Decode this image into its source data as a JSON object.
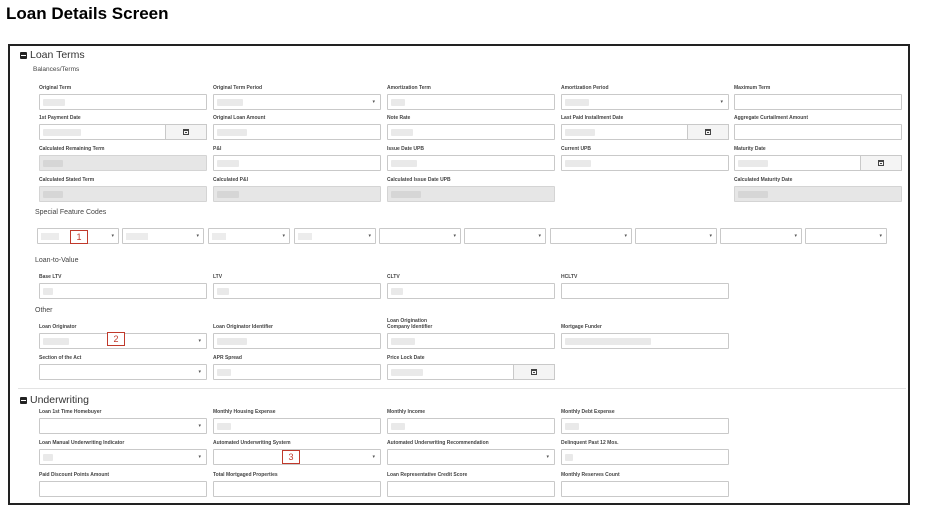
{
  "page": {
    "title": "Loan Details Screen"
  },
  "loan_terms": {
    "heading": "Loan Terms",
    "balances_heading": "Balances/Terms",
    "special_heading": "Special Feature Codes",
    "ltv_heading": "Loan-to-Value",
    "other_heading": "Other",
    "fields": {
      "original_term": "Original Term",
      "original_term_period": "Original Term Period",
      "amortization_term": "Amortization Term",
      "amortization_period": "Amortization Period",
      "maximum_term": "Maximum Term",
      "first_payment_date": "1st Payment Date",
      "original_loan_amount": "Original Loan Amount",
      "note_rate": "Note Rate",
      "last_paid_installment_date": "Last Paid Installment Date",
      "aggregate_curtailment_amount": "Aggregate Curtailment Amount",
      "calculated_remaining_term": "Calculated Remaining Term",
      "pi": "P&I",
      "issue_date_upb": "Issue Date UPB",
      "current_upb": "Current UPB",
      "maturity_date": "Maturity Date",
      "calculated_stated_term": "Calculated Stated Term",
      "calculated_pi": "Calculated P&I",
      "calculated_issue_date_upb": "Calculated Issue Date UPB",
      "calculated_maturity_date": "Calculated Maturity Date",
      "base_ltv": "Base LTV",
      "ltv": "LTV",
      "cltv": "CLTV",
      "hcltv": "HCLTV",
      "loan_originator": "Loan Originator",
      "loan_originator_identifier": "Loan Originator Identifier",
      "loan_origination_company_identifier_1": "Loan Origination",
      "loan_origination_company_identifier_2": "Company Identifier",
      "mortgage_funder": "Mortgage Funder",
      "section_of_the_act": "Section of the Act",
      "apr_spread": "APR Spread",
      "price_lock_date": "Price Lock Date"
    }
  },
  "underwriting": {
    "heading": "Underwriting",
    "fields": {
      "loan_1st_time_homebuyer": "Loan 1st Time Homebuyer",
      "monthly_housing_expense": "Monthly Housing Expense",
      "monthly_income": "Monthly Income",
      "monthly_debt_expense": "Monthly Debt Expense",
      "loan_manual_underwriting_indicator": "Loan Manual Underwriting Indicator",
      "automated_underwriting_system": "Automated Underwriting System",
      "automated_underwriting_recommendation": "Automated Underwriting Recommendation",
      "delinquent_past_12_mos": "Delinquent Past 12 Mos.",
      "paid_discount_points_amount": "Paid Discount Points Amount",
      "total_mortgaged_properties": "Total Mortgaged Properties",
      "loan_representative_credit_score": "Loan Representative Credit Score",
      "monthly_reserves_count": "Monthly Reserves Count"
    }
  },
  "callouts": {
    "c1": "1",
    "c2": "2",
    "c3": "3"
  },
  "icons": {
    "collapse": "minus-square-icon",
    "calendar": "calendar-icon",
    "dropdown": "caret-down-icon"
  },
  "glyphs": {
    "caret": "▾"
  }
}
